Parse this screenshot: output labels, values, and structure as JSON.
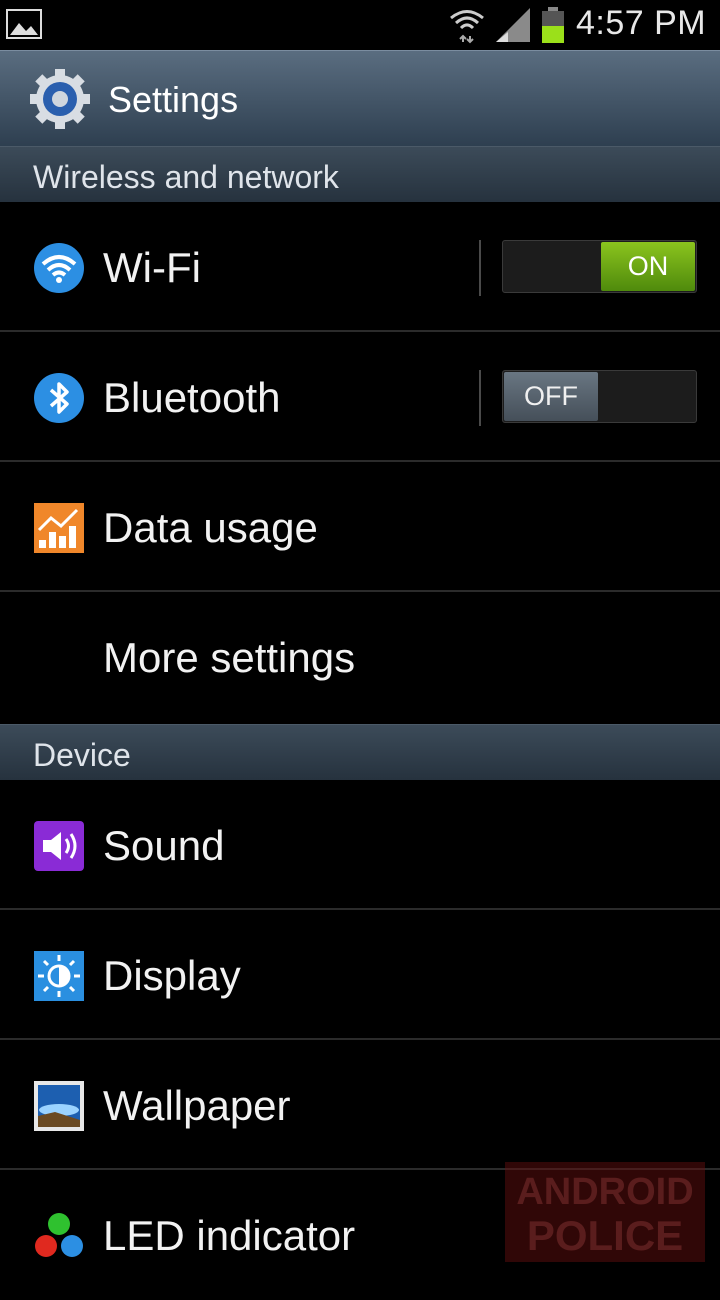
{
  "status_bar": {
    "time": "4:57 PM"
  },
  "action_bar": {
    "title": "Settings"
  },
  "sections": {
    "wireless": "Wireless and network",
    "device": "Device"
  },
  "items": {
    "wifi": {
      "label": "Wi-Fi",
      "toggle": "ON"
    },
    "bluetooth": {
      "label": "Bluetooth",
      "toggle": "OFF"
    },
    "data_usage": {
      "label": "Data usage"
    },
    "more_settings": {
      "label": "More settings"
    },
    "sound": {
      "label": "Sound"
    },
    "display": {
      "label": "Display"
    },
    "wallpaper": {
      "label": "Wallpaper"
    },
    "led_indicator": {
      "label": "LED indicator"
    }
  },
  "watermark": {
    "line1": "ANDROID",
    "line2": "POLICE"
  },
  "colors": {
    "toggle_on": "#6aa814",
    "toggle_off": "#56626d",
    "section_bg": "#2f3d4a"
  },
  "icons": {
    "status_left": "gallery-icon",
    "status_wifi": "wifi-icon",
    "status_signal": "signal-icon",
    "status_battery": "battery-icon",
    "title": "gear-icon"
  }
}
